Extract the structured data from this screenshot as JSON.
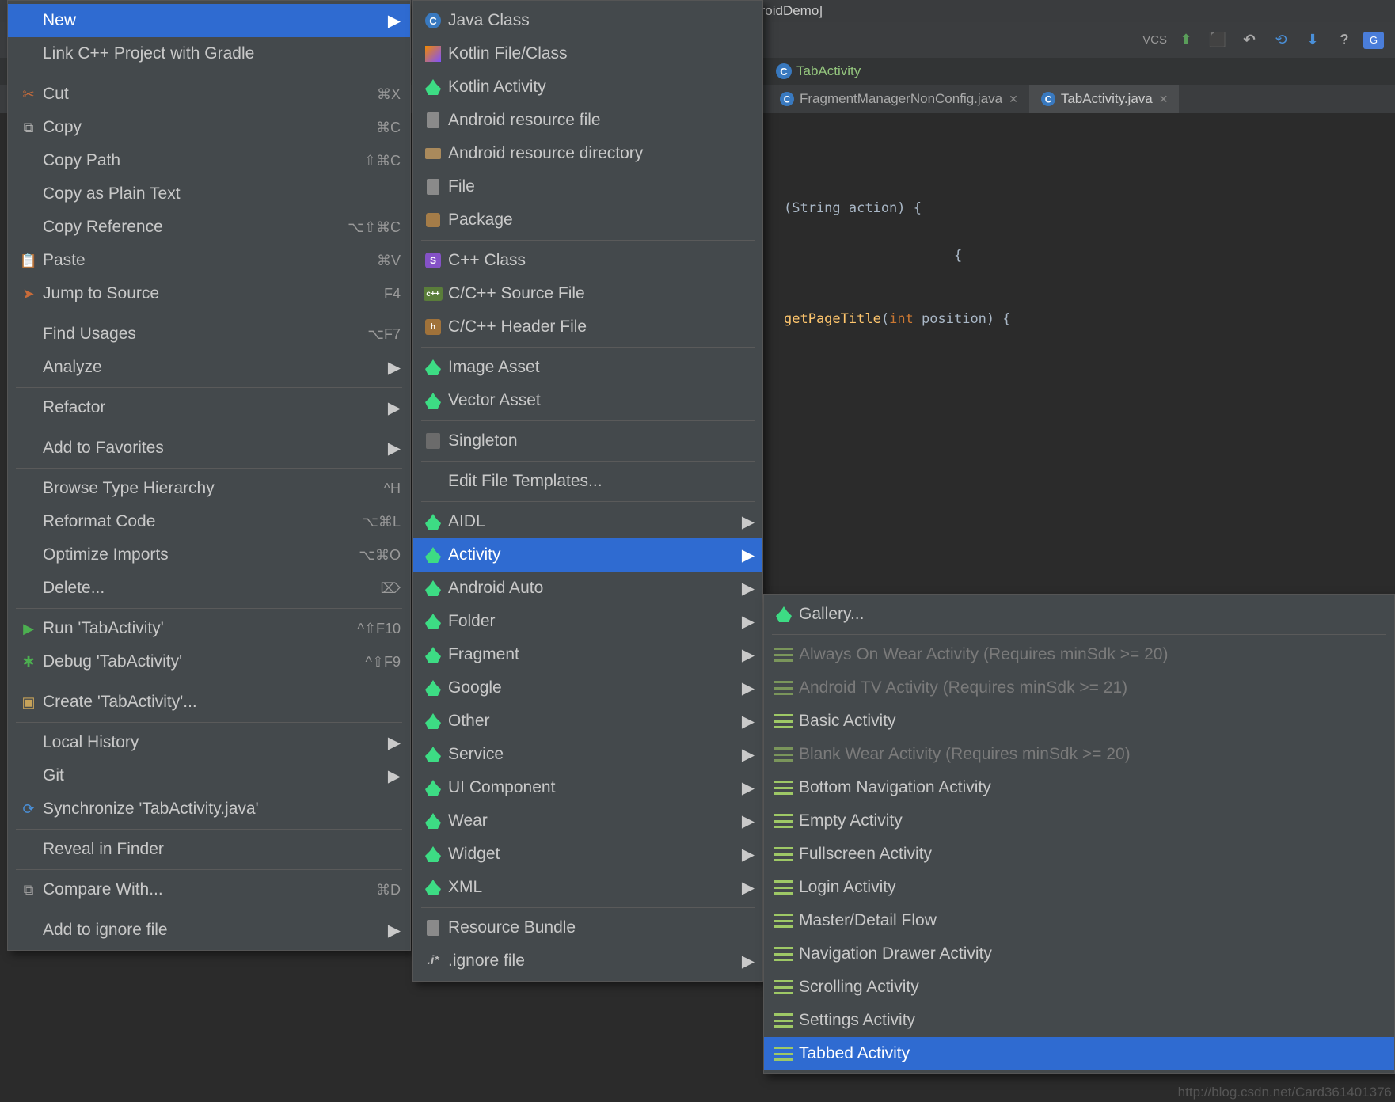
{
  "title": "ndroidDemo - [~/GitHub/MyAndroidDemo]",
  "toolbar": {
    "vcs": "VCS"
  },
  "breadcrumb": {
    "tab_activity": "TabActivity"
  },
  "editor_tabs": [
    {
      "label": "FragmentManagerNonConfig.java"
    },
    {
      "label": "TabActivity.java"
    }
  ],
  "code": {
    "line1a": "(String action) {",
    "line2a": "getPageTitle",
    "line2b": "(",
    "line2c": "int",
    "line2d": " position) {",
    "brace_open": " {"
  },
  "menu1": {
    "new": "New",
    "link_cpp": "Link C++ Project with Gradle",
    "cut": "Cut",
    "cut_key": "⌘X",
    "copy": "Copy",
    "copy_key": "⌘C",
    "copy_path": "Copy Path",
    "copy_path_key": "⇧⌘C",
    "copy_plain": "Copy as Plain Text",
    "copy_ref": "Copy Reference",
    "copy_ref_key": "⌥⇧⌘C",
    "paste": "Paste",
    "paste_key": "⌘V",
    "jump": "Jump to Source",
    "jump_key": "F4",
    "find_usages": "Find Usages",
    "find_usages_key": "⌥F7",
    "analyze": "Analyze",
    "refactor": "Refactor",
    "favorites": "Add to Favorites",
    "browse_hierarchy": "Browse Type Hierarchy",
    "browse_hierarchy_key": "^H",
    "reformat": "Reformat Code",
    "reformat_key": "⌥⌘L",
    "optimize": "Optimize Imports",
    "optimize_key": "⌥⌘O",
    "delete": "Delete...",
    "delete_key": "⌦",
    "run": "Run 'TabActivity'",
    "run_key": "^⇧F10",
    "debug": "Debug 'TabActivity'",
    "debug_key": "^⇧F9",
    "create_run": "Create 'TabActivity'...",
    "local_history": "Local History",
    "git": "Git",
    "sync": "Synchronize 'TabActivity.java'",
    "reveal": "Reveal in Finder",
    "compare": "Compare With...",
    "compare_key": "⌘D",
    "ignore": "Add to ignore file"
  },
  "menu2": {
    "java_class": "Java Class",
    "kotlin_file": "Kotlin File/Class",
    "kotlin_activity": "Kotlin Activity",
    "res_file": "Android resource file",
    "res_dir": "Android resource directory",
    "file": "File",
    "package": "Package",
    "cpp_class": "C++ Class",
    "cpp_source": "C/C++ Source File",
    "cpp_header": "C/C++ Header File",
    "image_asset": "Image Asset",
    "vector_asset": "Vector Asset",
    "singleton": "Singleton",
    "edit_templates": "Edit File Templates...",
    "aidl": "AIDL",
    "activity": "Activity",
    "android_auto": "Android Auto",
    "folder": "Folder",
    "fragment": "Fragment",
    "google": "Google",
    "other": "Other",
    "service": "Service",
    "ui_component": "UI Component",
    "wear": "Wear",
    "widget": "Widget",
    "xml": "XML",
    "resource_bundle": "Resource Bundle",
    "ignore_file": ".ignore file",
    "ignore_prefix": ".i*"
  },
  "menu3": {
    "gallery": "Gallery...",
    "always_on_wear": "Always On Wear Activity (Requires minSdk >= 20)",
    "android_tv": "Android TV Activity (Requires minSdk >= 21)",
    "basic": "Basic Activity",
    "blank_wear": "Blank Wear Activity (Requires minSdk >= 20)",
    "bottom_nav": "Bottom Navigation Activity",
    "empty": "Empty Activity",
    "fullscreen": "Fullscreen Activity",
    "login": "Login Activity",
    "master_detail": "Master/Detail Flow",
    "nav_drawer": "Navigation Drawer Activity",
    "scrolling": "Scrolling Activity",
    "settings": "Settings Activity",
    "tabbed": "Tabbed Activity"
  },
  "watermark": "http://blog.csdn.net/Card361401376"
}
